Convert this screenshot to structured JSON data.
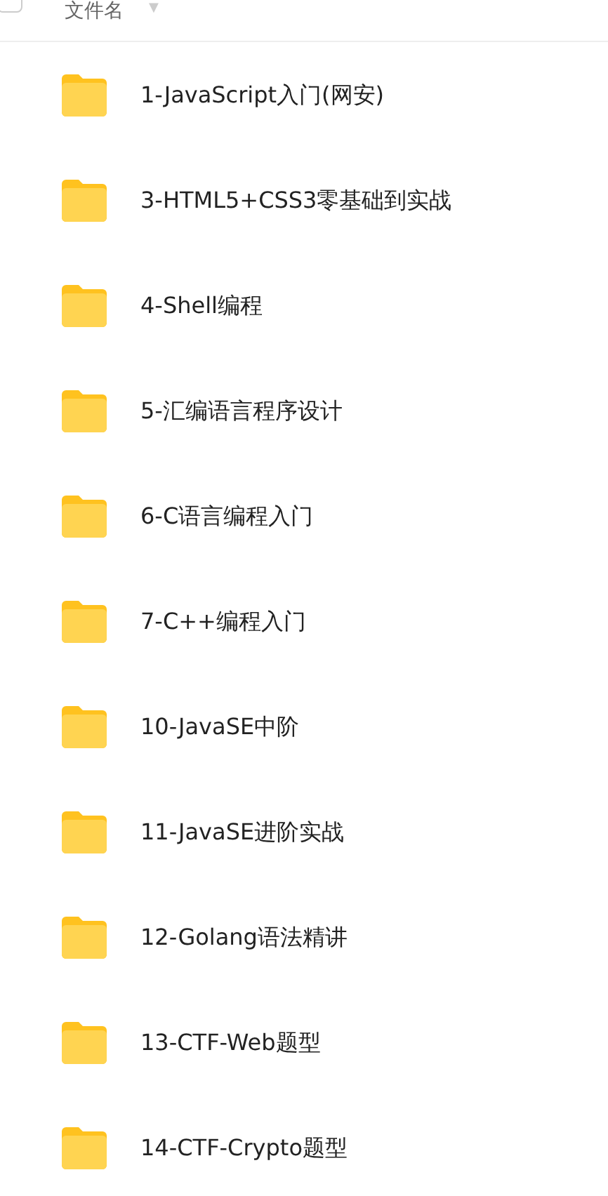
{
  "header": {
    "checked": false,
    "column_label": "文件名",
    "sort_caret": "▼"
  },
  "files": [
    {
      "name": "1-JavaScript入门(网安)"
    },
    {
      "name": "3-HTML5+CSS3零基础到实战"
    },
    {
      "name": "4-Shell编程"
    },
    {
      "name": "5-汇编语言程序设计"
    },
    {
      "name": "6-C语言编程入门"
    },
    {
      "name": "7-C++编程入门"
    },
    {
      "name": "10-JavaSE中阶"
    },
    {
      "name": "11-JavaSE进阶实战"
    },
    {
      "name": "12-Golang语法精讲"
    },
    {
      "name": "13-CTF-Web题型"
    },
    {
      "name": "14-CTF-Crypto题型"
    }
  ]
}
